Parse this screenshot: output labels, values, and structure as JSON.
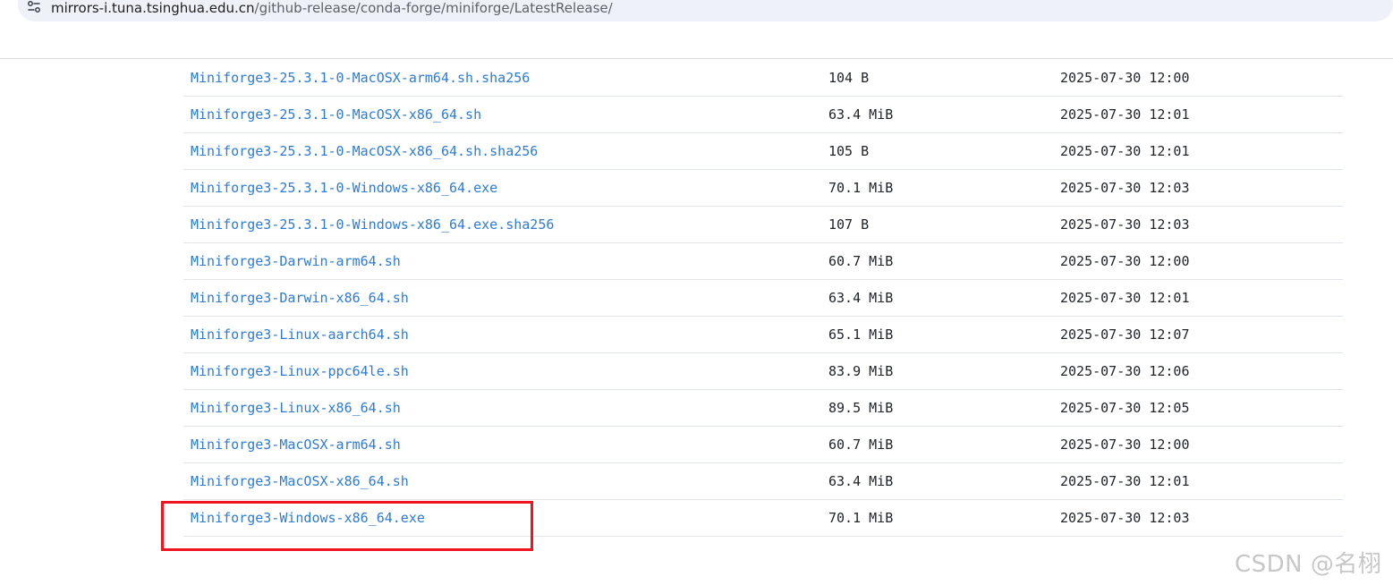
{
  "browser": {
    "url_host": "mirrors-i.tuna.tsinghua.edu.cn",
    "url_path": "/github-release/conda-forge/miniforge/LatestRelease/",
    "site_info_icon": "tune-icon"
  },
  "listing": {
    "rows": [
      {
        "name": "Miniforge3-25.3.1-0-MacOSX-arm64.sh.sha256",
        "size": "104 B",
        "date": "2025-07-30 12:00"
      },
      {
        "name": "Miniforge3-25.3.1-0-MacOSX-x86_64.sh",
        "size": "63.4 MiB",
        "date": "2025-07-30 12:01"
      },
      {
        "name": "Miniforge3-25.3.1-0-MacOSX-x86_64.sh.sha256",
        "size": "105 B",
        "date": "2025-07-30 12:01"
      },
      {
        "name": "Miniforge3-25.3.1-0-Windows-x86_64.exe",
        "size": "70.1 MiB",
        "date": "2025-07-30 12:03"
      },
      {
        "name": "Miniforge3-25.3.1-0-Windows-x86_64.exe.sha256",
        "size": "107 B",
        "date": "2025-07-30 12:03"
      },
      {
        "name": "Miniforge3-Darwin-arm64.sh",
        "size": "60.7 MiB",
        "date": "2025-07-30 12:00"
      },
      {
        "name": "Miniforge3-Darwin-x86_64.sh",
        "size": "63.4 MiB",
        "date": "2025-07-30 12:01"
      },
      {
        "name": "Miniforge3-Linux-aarch64.sh",
        "size": "65.1 MiB",
        "date": "2025-07-30 12:07"
      },
      {
        "name": "Miniforge3-Linux-ppc64le.sh",
        "size": "83.9 MiB",
        "date": "2025-07-30 12:06"
      },
      {
        "name": "Miniforge3-Linux-x86_64.sh",
        "size": "89.5 MiB",
        "date": "2025-07-30 12:05"
      },
      {
        "name": "Miniforge3-MacOSX-arm64.sh",
        "size": "60.7 MiB",
        "date": "2025-07-30 12:00"
      },
      {
        "name": "Miniforge3-MacOSX-x86_64.sh",
        "size": "63.4 MiB",
        "date": "2025-07-30 12:01"
      },
      {
        "name": "Miniforge3-Windows-x86_64.exe",
        "size": "70.1 MiB",
        "date": "2025-07-30 12:03"
      }
    ]
  },
  "watermark": "CSDN @名栩",
  "colors": {
    "link": "#2d7bd6",
    "highlight": "#f0141e"
  }
}
